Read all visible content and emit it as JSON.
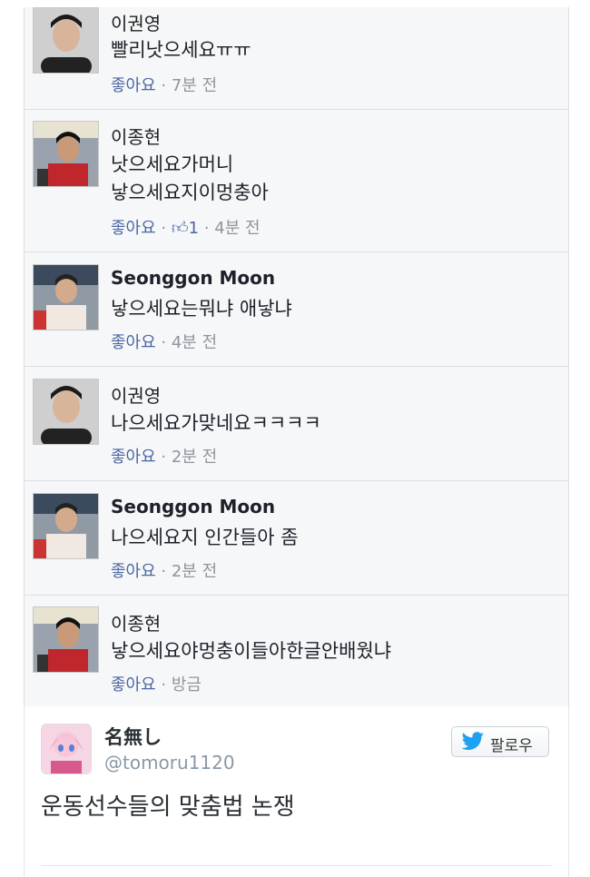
{
  "comments": [
    {
      "name": "이권영",
      "bold": false,
      "lines": [
        "빨리낫으세요ㅠㅠ"
      ],
      "like": "좋아요",
      "likes": "",
      "time": "7분 전"
    },
    {
      "name": "이종현",
      "bold": false,
      "lines": [
        "낫으세요가머니",
        "낳으세요지이멍충아"
      ],
      "like": "좋아요",
      "likes": "1",
      "time": "4분 전"
    },
    {
      "name": "Seonggon Moon",
      "bold": true,
      "lines": [
        "낳으세요는뭐냐 애낳냐"
      ],
      "like": "좋아요",
      "likes": "",
      "time": "4분 전"
    },
    {
      "name": "이권영",
      "bold": false,
      "lines": [
        "나으세요가맞네요ㅋㅋㅋㅋ"
      ],
      "like": "좋아요",
      "likes": "",
      "time": "2분 전"
    },
    {
      "name": "Seonggon Moon",
      "bold": true,
      "lines": [
        "나으세요지 인간들아 좀"
      ],
      "like": "좋아요",
      "likes": "",
      "time": "2분 전"
    },
    {
      "name": "이종현",
      "bold": false,
      "lines": [
        "낳으세요야멍충이들아한글안배웠냐"
      ],
      "like": "좋아요",
      "likes": "",
      "time": "방금"
    }
  ],
  "separator": " · ",
  "tweet": {
    "name": "名無し",
    "handle": "@tomoru1120",
    "follow_label": "팔로우",
    "text": "운동선수들의 맞춤법 논쟁"
  },
  "colors": {
    "link": "#4b67a1",
    "meta": "#90949c",
    "twitter": "#1da1f2"
  }
}
